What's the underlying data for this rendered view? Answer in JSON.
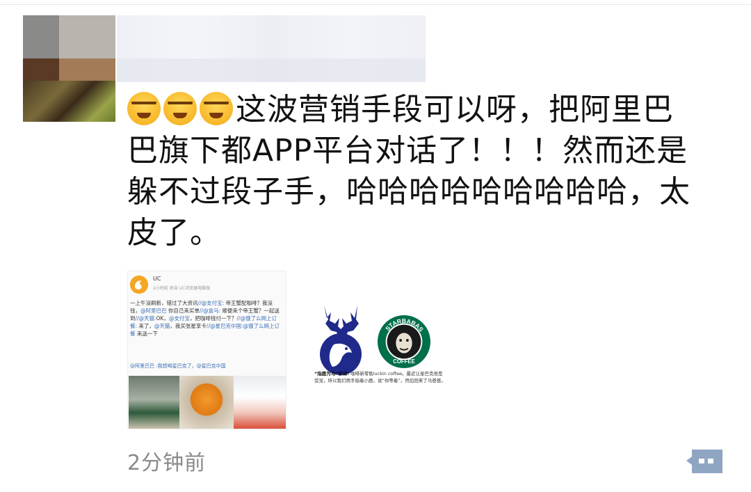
{
  "post": {
    "emoji_count": 3,
    "text_line1": "这波营销手段可以呀，把阿里巴",
    "text_line2": "巴旗下都APP平台对话了！！！然而还是",
    "text_line3": "躲不过段子手，哈哈哈哈哈哈哈哈哈，太",
    "text_line4": "皮了。",
    "emoji_icon": "face-with-tears-of-joy-icon"
  },
  "uc_card": {
    "name": "UC",
    "meta": "2小时前  来自 UC浏览器电脑版",
    "body_parts": [
      {
        "t": "一上午没刷新，错过了大资讯",
        "c": "n"
      },
      {
        "t": "//@支付宝:",
        "c": "b"
      },
      {
        "t": " 帝王蟹配咖啡？我没钱，",
        "c": "n"
      },
      {
        "t": "@阿里巴巴",
        "c": "b"
      },
      {
        "t": " 你自己来买单",
        "c": "n"
      },
      {
        "t": "//@盒马:",
        "c": "b"
      },
      {
        "t": " 顺便来个帝王蟹？一起送到",
        "c": "n"
      },
      {
        "t": "//@天猫:",
        "c": "b"
      },
      {
        "t": "OK，",
        "c": "n"
      },
      {
        "t": "@支付宝",
        "c": "b"
      },
      {
        "t": "，把咖啡钱付一下？",
        "c": "n"
      },
      {
        "t": "//@饿了么网上订餐:",
        "c": "b"
      },
      {
        "t": " 来了，",
        "c": "n"
      },
      {
        "t": "@天猫",
        "c": "b"
      },
      {
        "t": "，我买张星享卡",
        "c": "n"
      },
      {
        "t": "//@星巴克中国:",
        "c": "b"
      },
      {
        "t": "@饿了么网上订餐",
        "c": "b"
      },
      {
        "t": " 来送一下",
        "c": "n"
      }
    ],
    "mention_line": "@阿里巴巴 :我想喝星巴克了，@星巴克中国"
  },
  "luckin_card": {
    "brand_logo": "STARBABAS COFFEE",
    "caption_bold": "“指鹿为马”新译:",
    "caption_rest": " 咖啡新零售luckin coffee。最近让星巴克很是受宠，所以我们用手指着小鹿，说“你等着”，然后回来了马爸爸。"
  },
  "footer": {
    "time": "2分钟前",
    "comment_icon": "comment-bubble-icon"
  },
  "colors": {
    "text": "#111111",
    "time": "#8a8a8a",
    "comment_button": "#8fa6c3",
    "luckin_blue": "#1f2a8a",
    "starbucks_green": "#00704a",
    "uc_link": "#3b6fb6"
  }
}
